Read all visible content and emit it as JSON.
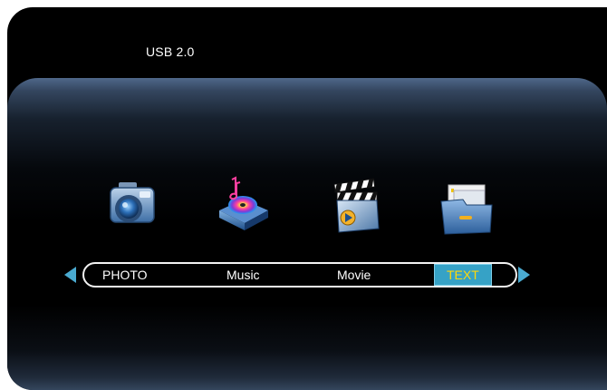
{
  "header": {
    "source_label": "USB 2.0"
  },
  "menu": {
    "items": [
      {
        "label": "PHOTO",
        "icon": "camera-icon"
      },
      {
        "label": "Music",
        "icon": "music-disc-icon"
      },
      {
        "label": "Movie",
        "icon": "clapperboard-icon"
      },
      {
        "label": "TEXT",
        "icon": "folder-icon",
        "selected": true
      }
    ],
    "left_arrow": "left-arrow-icon",
    "right_arrow": "right-arrow-icon"
  },
  "colors": {
    "background": "#000000",
    "panel_top": "#4f6789",
    "selected_bg": "#36a2c6",
    "selected_text": "#ffd80a",
    "arrow": "#4aaad0"
  }
}
